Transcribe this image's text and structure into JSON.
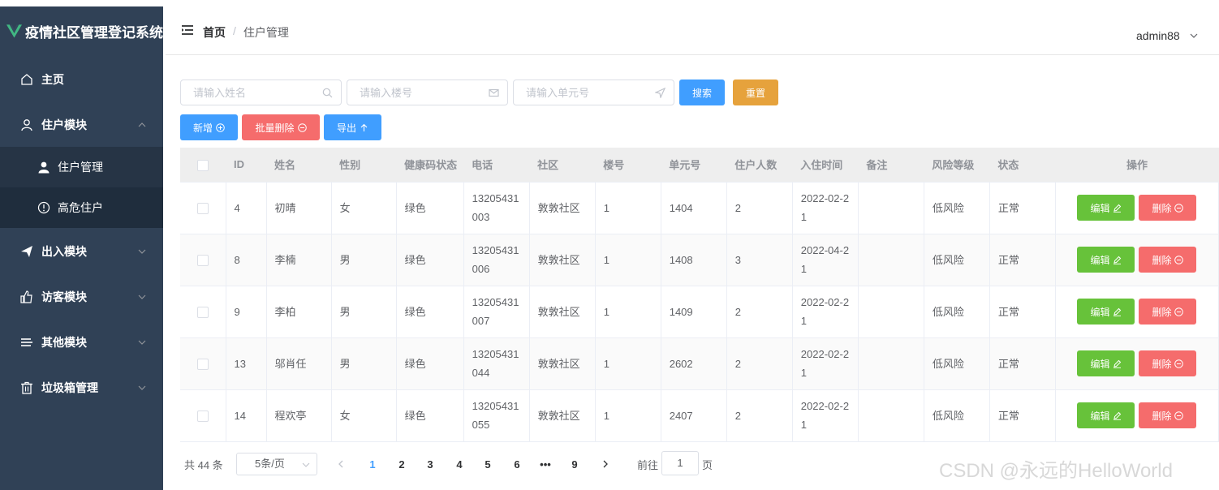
{
  "sidebar": {
    "title": "疫情社区管理登记系统",
    "items": [
      {
        "label": "主页",
        "icon": "house-icon"
      },
      {
        "label": "住户模块",
        "icon": "user-icon",
        "expanded": true,
        "children": [
          {
            "label": "住户管理",
            "icon": "user-solid-icon",
            "active": true
          },
          {
            "label": "高危住户",
            "icon": "warning-circle-icon",
            "active": false
          }
        ]
      },
      {
        "label": "出入模块",
        "icon": "paper-plane-icon"
      },
      {
        "label": "访客模块",
        "icon": "thumb-icon"
      },
      {
        "label": "其他模块",
        "icon": "list-icon"
      },
      {
        "label": "垃圾箱管理",
        "icon": "trash-icon"
      }
    ]
  },
  "header": {
    "breadcrumb": {
      "home": "首页",
      "separator": "/",
      "current": "住户管理"
    },
    "user": "admin88"
  },
  "search": {
    "name_placeholder": "请输入姓名",
    "building_placeholder": "请输入楼号",
    "unit_placeholder": "请输入单元号",
    "search_label": "搜索",
    "reset_label": "重置"
  },
  "toolbar": {
    "add_label": "新增",
    "batch_delete_label": "批量删除",
    "export_label": "导出"
  },
  "table": {
    "columns": [
      "ID",
      "姓名",
      "性别",
      "健康码状态",
      "电话",
      "社区",
      "楼号",
      "单元号",
      "住户人数",
      "入住时间",
      "备注",
      "风险等级",
      "状态",
      "操作"
    ],
    "rows": [
      {
        "id": "4",
        "name": "初晴",
        "gender": "女",
        "health": "绿色",
        "phone": "13205431003",
        "community": "敦敦社区",
        "building": "1",
        "unit": "1404",
        "count": "2",
        "date": "2022-02-21",
        "note": "",
        "risk": "低风险",
        "status": "正常"
      },
      {
        "id": "8",
        "name": "李楠",
        "gender": "男",
        "health": "绿色",
        "phone": "13205431006",
        "community": "敦敦社区",
        "building": "1",
        "unit": "1408",
        "count": "3",
        "date": "2022-04-21",
        "note": "",
        "risk": "低风险",
        "status": "正常"
      },
      {
        "id": "9",
        "name": "李柏",
        "gender": "男",
        "health": "绿色",
        "phone": "13205431007",
        "community": "敦敦社区",
        "building": "1",
        "unit": "1409",
        "count": "2",
        "date": "2022-02-21",
        "note": "",
        "risk": "低风险",
        "status": "正常"
      },
      {
        "id": "13",
        "name": "邬肖任",
        "gender": "男",
        "health": "绿色",
        "phone": "13205431044",
        "community": "敦敦社区",
        "building": "1",
        "unit": "2602",
        "count": "2",
        "date": "2022-02-21",
        "note": "",
        "risk": "低风险",
        "status": "正常"
      },
      {
        "id": "14",
        "name": "程欢亭",
        "gender": "女",
        "health": "绿色",
        "phone": "13205431055",
        "community": "敦敦社区",
        "building": "1",
        "unit": "2407",
        "count": "2",
        "date": "2022-02-21",
        "note": "",
        "risk": "低风险",
        "status": "正常"
      }
    ],
    "edit_label": "编辑",
    "delete_label": "删除"
  },
  "pagination": {
    "total": "共 44 条",
    "page_size": "5条/页",
    "pages": [
      "1",
      "2",
      "3",
      "4",
      "5",
      "6",
      "•••",
      "9"
    ],
    "current": "1",
    "goto_prefix": "前往",
    "goto_value": "1",
    "goto_suffix": "页"
  },
  "watermark": "CSDN @永远的HelloWorld",
  "colors": {
    "sidebar_bg": "#304156",
    "primary": "#409eff",
    "warning": "#e6a23c",
    "danger": "#f56c6c",
    "success": "#67c23a",
    "brand_green": "#41b883"
  }
}
